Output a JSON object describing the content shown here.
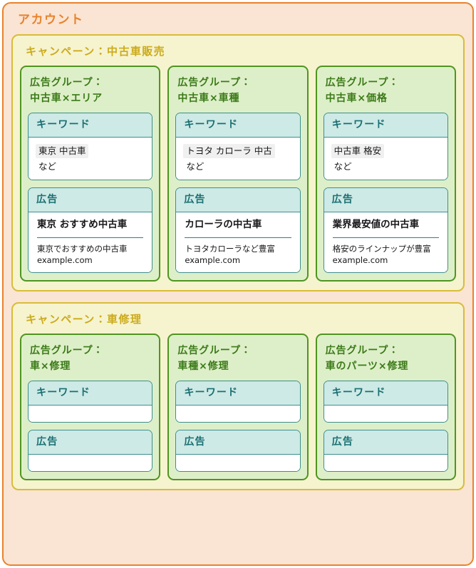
{
  "account": {
    "title": "アカウント",
    "border_color": "#e8832d",
    "background_color": "#fae4d3"
  },
  "labels": {
    "keyword_header": "キーワード",
    "ad_header": "広告",
    "etc": "など",
    "campaign_border_color": "#d8bd39",
    "campaign_title_color": "#ccab1a",
    "adgroup_border_color": "#4f9521",
    "adgroup_title_color": "#3b7a18",
    "panel_border_color": "#3d8e8e",
    "panel_header_bg": "#cdeae6"
  },
  "campaigns": [
    {
      "title": "キャンペーン：中古車販売",
      "adgroups": [
        {
          "title": "広告グループ：\n中古車×エリア",
          "keyword": {
            "header": "キーワード",
            "term": "東京 中古車",
            "etc": "など"
          },
          "ad": {
            "header": "広告",
            "title": "東京 おすすめ中古車",
            "description": "東京でおすすめの中古車",
            "url": "example.com"
          }
        },
        {
          "title": "広告グループ：\n中古車×車種",
          "keyword": {
            "header": "キーワード",
            "term": "トヨタ カローラ 中古",
            "etc": "など"
          },
          "ad": {
            "header": "広告",
            "title": "カローラの中古車",
            "description": "トヨタカローラなど豊富",
            "url": "example.com"
          }
        },
        {
          "title": "広告グループ：\n中古車×価格",
          "keyword": {
            "header": "キーワード",
            "term": "中古車 格安",
            "etc": "など"
          },
          "ad": {
            "header": "広告",
            "title": "業界最安値の中古車",
            "description": "格安のラインナップが豊富",
            "url": "example.com"
          }
        }
      ]
    },
    {
      "title": "キャンペーン：車修理",
      "adgroups": [
        {
          "title": "広告グループ：\n車×修理",
          "keyword": {
            "header": "キーワード"
          },
          "ad": {
            "header": "広告"
          }
        },
        {
          "title": "広告グループ：\n車種×修理",
          "keyword": {
            "header": "キーワード"
          },
          "ad": {
            "header": "広告"
          }
        },
        {
          "title": "広告グループ：\n車のパーツ×修理",
          "keyword": {
            "header": "キーワード"
          },
          "ad": {
            "header": "広告"
          }
        }
      ]
    }
  ]
}
